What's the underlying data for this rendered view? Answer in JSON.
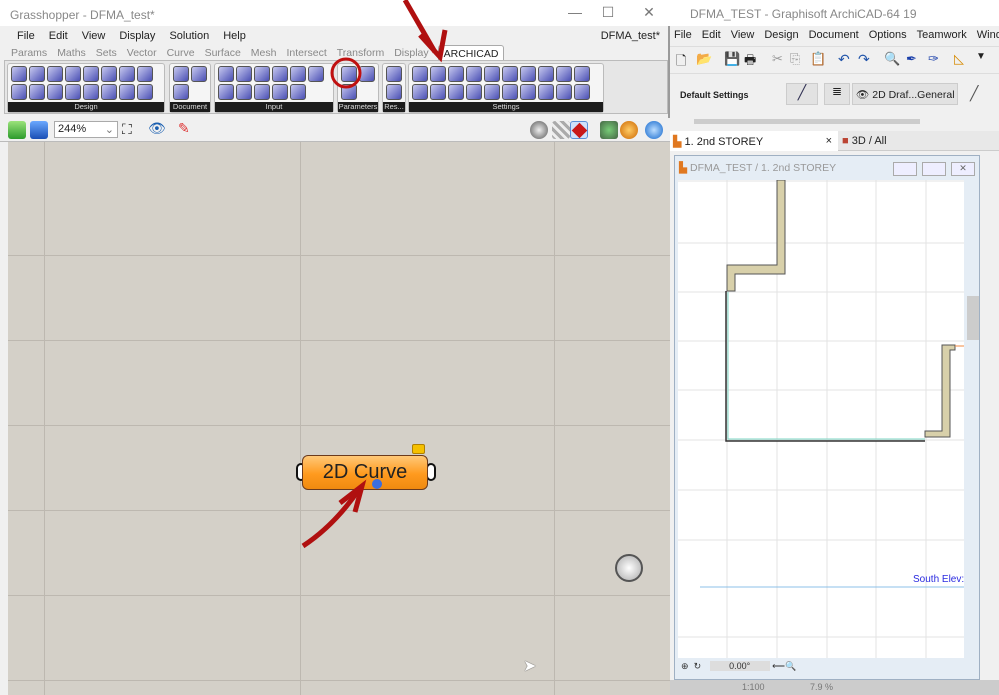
{
  "grasshopper": {
    "title": "Grasshopper - DFMA_test*",
    "doc_name": "DFMA_test*",
    "window_controls": [
      "minimize-icon",
      "maximize-icon",
      "close-icon"
    ],
    "menu": [
      "File",
      "Edit",
      "View",
      "Display",
      "Solution",
      "Help"
    ],
    "tabs": [
      "Params",
      "Maths",
      "Sets",
      "Vector",
      "Curve",
      "Surface",
      "Mesh",
      "Intersect",
      "Transform",
      "Display",
      "ARCHICAD"
    ],
    "active_tab": "ARCHICAD",
    "ribbon_groups": [
      {
        "label": "Design",
        "icons": 16
      },
      {
        "label": "Document",
        "icons": 3
      },
      {
        "label": "Input",
        "icons": 11
      },
      {
        "label": "Parameters",
        "icons": 3
      },
      {
        "label": "Res...",
        "icons": 2
      },
      {
        "label": "Settings",
        "icons": 20
      }
    ],
    "zoom": "244%",
    "node": {
      "label": "2D Curve",
      "color": "#ff9a1e"
    },
    "annotation_color": "#b01010"
  },
  "archicad": {
    "title": "DFMA_TEST - Graphisoft ArchiCAD-64 19",
    "menu": [
      "File",
      "Edit",
      "View",
      "Design",
      "Document",
      "Options",
      "Teamwork",
      "Wind"
    ],
    "info_label": "Default Settings",
    "layer_combo": "2D Draf...General",
    "tabs": [
      {
        "label": "1. 2nd STOREY",
        "icon": "floor-plan-icon"
      },
      {
        "label": "3D / All",
        "icon": "camera-icon"
      }
    ],
    "subwindow_title": "DFMA_TEST / 1. 2nd STOREY",
    "elevation_marker": "South Elev:",
    "angle": "0.00°",
    "scale": "1:100",
    "zoom": "7.9 %"
  }
}
